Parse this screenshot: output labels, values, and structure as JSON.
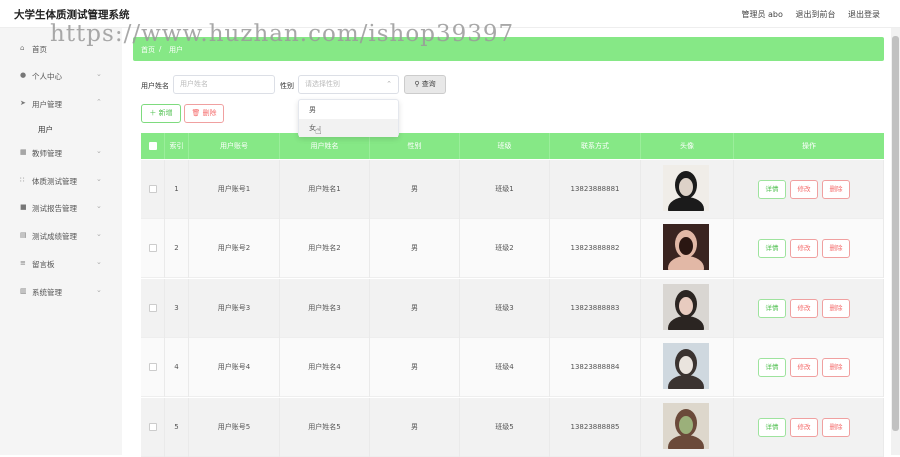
{
  "header": {
    "app_title": "大学生体质测试管理系统",
    "user_label": "管理员 abo",
    "back_label": "退出到前台",
    "logout_label": "退出登录"
  },
  "watermark": "https://www.huzhan.com/ishop39397",
  "sidebar": {
    "items": [
      {
        "label": "首页",
        "icon": "home-icon"
      },
      {
        "label": "个人中心",
        "icon": "user-icon"
      },
      {
        "label": "用户管理",
        "icon": "send-icon"
      },
      {
        "label": "教师管理",
        "icon": "grid-icon"
      },
      {
        "label": "体质测试管理",
        "icon": "apps-icon"
      },
      {
        "label": "测试报告管理",
        "icon": "report-icon"
      },
      {
        "label": "测试成绩管理",
        "icon": "score-icon"
      },
      {
        "label": "留言板",
        "icon": "message-icon"
      },
      {
        "label": "系统管理",
        "icon": "system-icon"
      }
    ],
    "sub_item": "用户"
  },
  "breadcrumb": {
    "home": "首页",
    "sep": "/",
    "current": "用户"
  },
  "search": {
    "name_label": "用户姓名",
    "name_placeholder": "用户姓名",
    "gender_label": "性别",
    "gender_placeholder": "请选择性别",
    "query_label": "查询",
    "options": [
      "男",
      "女"
    ]
  },
  "actions": {
    "add_label": "新增",
    "delete_label": "删除"
  },
  "table": {
    "headers": [
      "索引",
      "用户账号",
      "用户姓名",
      "性别",
      "班级",
      "联系方式",
      "头像",
      "操作"
    ],
    "rows": [
      {
        "index": "1",
        "account": "用户账号1",
        "name": "用户姓名1",
        "gender": "男",
        "class": "班级1",
        "phone": "13823888881"
      },
      {
        "index": "2",
        "account": "用户账号2",
        "name": "用户姓名2",
        "gender": "男",
        "class": "班级2",
        "phone": "13823888882"
      },
      {
        "index": "3",
        "account": "用户账号3",
        "name": "用户姓名3",
        "gender": "男",
        "class": "班级3",
        "phone": "13823888883"
      },
      {
        "index": "4",
        "account": "用户账号4",
        "name": "用户姓名4",
        "gender": "男",
        "class": "班级4",
        "phone": "13823888884"
      },
      {
        "index": "5",
        "account": "用户账号5",
        "name": "用户姓名5",
        "gender": "男",
        "class": "班级5",
        "phone": "13823888885"
      }
    ],
    "row_actions": {
      "detail": "详情",
      "edit": "修改",
      "delete": "删除"
    }
  },
  "colors": {
    "accent": "#86e886",
    "danger": "#f56c6c",
    "success": "#4cbf4c"
  }
}
